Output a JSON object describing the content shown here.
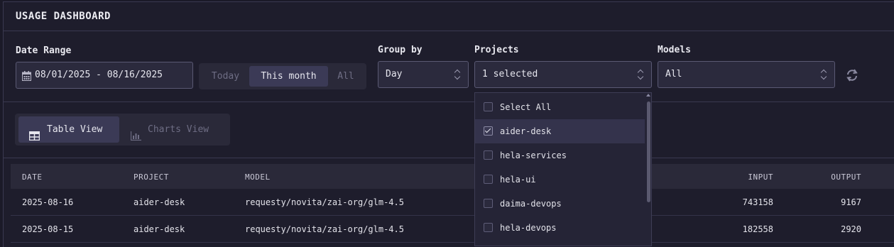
{
  "header": {
    "title": "USAGE DASHBOARD"
  },
  "filters": {
    "date_range_label": "Date Range",
    "date_range_value": "08/01/2025 - 08/16/2025",
    "presets": [
      "Today",
      "This month",
      "All"
    ],
    "active_preset": "This month",
    "group_by_label": "Group by",
    "group_by_value": "Day",
    "projects_label": "Projects",
    "projects_value": "1 selected",
    "models_label": "Models",
    "models_value": "All",
    "refresh_icon": "refresh-icon"
  },
  "views": {
    "table_label": "Table View",
    "charts_label": "Charts View",
    "active": "Table View"
  },
  "table": {
    "columns": [
      "DATE",
      "PROJECT",
      "MODEL",
      "INPUT",
      "OUTPUT"
    ],
    "rows": [
      {
        "date": "2025-08-16",
        "project": "aider-desk",
        "model": "requesty/novita/zai-org/glm-4.5",
        "input": "743158",
        "output": "9167"
      },
      {
        "date": "2025-08-15",
        "project": "aider-desk",
        "model": "requesty/novita/zai-org/glm-4.5",
        "input": "182558",
        "output": "2920"
      }
    ]
  },
  "projects_dropdown": {
    "items": [
      {
        "label": "Select All",
        "checked": false
      },
      {
        "label": "aider-desk",
        "checked": true
      },
      {
        "label": "hela-services",
        "checked": false
      },
      {
        "label": "hela-ui",
        "checked": false
      },
      {
        "label": "daima-devops",
        "checked": false
      },
      {
        "label": "hela-devops",
        "checked": false
      }
    ]
  },
  "colors": {
    "background": "#1e1d2c",
    "accent": "#3b3a56",
    "border": "#5a5973"
  }
}
